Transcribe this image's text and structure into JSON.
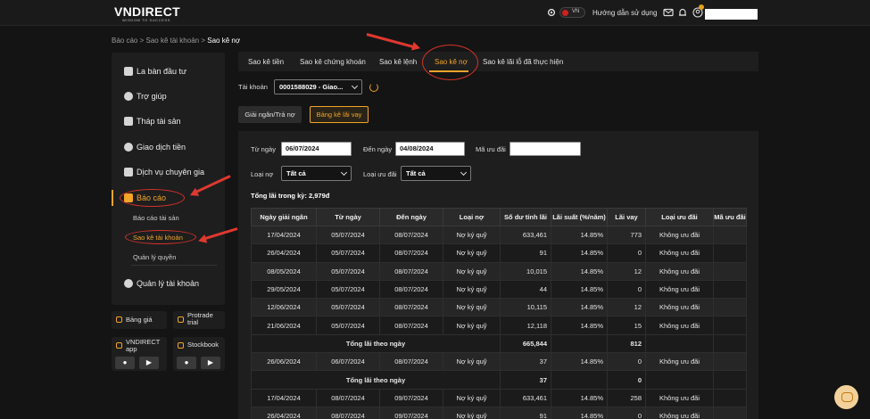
{
  "header": {
    "logo": "VNDIRECT",
    "tagline": "WISDOM TO SUCCESS",
    "lang": "VN",
    "guide": "Hướng dẫn sử dụng"
  },
  "breadcrumb": [
    "Báo cáo",
    ">",
    "Sao kê tài khoản",
    ">",
    "Sao kê nợ"
  ],
  "sidebar": {
    "items": [
      {
        "label": "La bàn đầu tư"
      },
      {
        "label": "Trợ giúp"
      },
      {
        "label": "Tháp tài sản"
      },
      {
        "label": "Giao dịch tiền"
      },
      {
        "label": "Dịch vụ chuyên gia"
      },
      {
        "label": "Báo cáo"
      },
      {
        "label": "Quản lý tài khoản"
      }
    ],
    "sub_items": [
      {
        "label": "Báo cáo tài sản"
      },
      {
        "label": "Sao kê tài khoản"
      },
      {
        "label": "Quản lý quyền"
      }
    ],
    "quick": [
      {
        "label": "Bảng giá"
      },
      {
        "label": "Protrade trial"
      },
      {
        "label": "VNDIRECT app"
      },
      {
        "label": "Stockbook"
      }
    ]
  },
  "tabs": [
    "Sao kê tiền",
    "Sao kê chứng khoán",
    "Sao kê lệnh",
    "Sao kê nợ",
    "Sao kê lãi lỗ đã thực hiện"
  ],
  "account": {
    "label": "Tài khoản",
    "value": "0001588029 - Giao..."
  },
  "subtabs": [
    "Giải ngân/Trả nợ",
    "Bảng kê lãi vay"
  ],
  "filters": {
    "from_label": "Từ ngày",
    "from_value": "06/07/2024",
    "to_label": "Đến ngày",
    "to_value": "04/08/2024",
    "promo_code_label": "Mã ưu đãi",
    "promo_code_value": "",
    "debt_type_label": "Loại nợ",
    "debt_type_value": "Tất cả",
    "promo_type_label": "Loại ưu đãi",
    "promo_type_value": "Tất cả"
  },
  "total_interest": "Tổng lãi trong kỳ: 2,979đ",
  "table": {
    "headers": [
      "Ngày giải ngân",
      "Từ ngày",
      "Đến ngày",
      "Loại nợ",
      "Số dư tính lãi",
      "Lãi suất (%/năm)",
      "Lãi vay",
      "Loại ưu đãi",
      "Mã ưu đãi"
    ],
    "rows": [
      {
        "type": "data",
        "cells": [
          "17/04/2024",
          "05/07/2024",
          "08/07/2024",
          "Nợ ký quỹ",
          "633,461",
          "14.85%",
          "773",
          "Không ưu đãi",
          ""
        ]
      },
      {
        "type": "data",
        "cells": [
          "26/04/2024",
          "05/07/2024",
          "08/07/2024",
          "Nợ ký quỹ",
          "91",
          "14.85%",
          "0",
          "Không ưu đãi",
          ""
        ]
      },
      {
        "type": "data",
        "cells": [
          "08/05/2024",
          "05/07/2024",
          "08/07/2024",
          "Nợ ký quỹ",
          "10,015",
          "14.85%",
          "12",
          "Không ưu đãi",
          ""
        ]
      },
      {
        "type": "data",
        "cells": [
          "29/05/2024",
          "05/07/2024",
          "08/07/2024",
          "Nợ ký quỹ",
          "44",
          "14.85%",
          "0",
          "Không ưu đãi",
          ""
        ]
      },
      {
        "type": "data",
        "cells": [
          "12/06/2024",
          "05/07/2024",
          "08/07/2024",
          "Nợ ký quỹ",
          "10,115",
          "14.85%",
          "12",
          "Không ưu đãi",
          ""
        ]
      },
      {
        "type": "data",
        "cells": [
          "21/06/2024",
          "05/07/2024",
          "08/07/2024",
          "Nợ ký quỹ",
          "12,118",
          "14.85%",
          "15",
          "Không ưu đãi",
          ""
        ]
      },
      {
        "type": "sum",
        "label": "Tổng lãi theo ngày",
        "balance": "665,844",
        "interest": "812"
      },
      {
        "type": "data",
        "cells": [
          "26/06/2024",
          "06/07/2024",
          "08/07/2024",
          "Nợ ký quỹ",
          "37",
          "14.85%",
          "0",
          "Không ưu đãi",
          ""
        ]
      },
      {
        "type": "sum",
        "label": "Tổng lãi theo ngày",
        "balance": "37",
        "interest": "0"
      },
      {
        "type": "data",
        "cells": [
          "17/04/2024",
          "08/07/2024",
          "09/07/2024",
          "Nợ ký quỹ",
          "633,461",
          "14.85%",
          "258",
          "Không ưu đãi",
          ""
        ]
      },
      {
        "type": "data",
        "cells": [
          "26/04/2024",
          "08/07/2024",
          "09/07/2024",
          "Nợ ký quỹ",
          "91",
          "14.85%",
          "0",
          "Không ưu đãi",
          ""
        ]
      }
    ]
  },
  "colors": {
    "accent": "#f1a428",
    "annotation": "#e0382f",
    "background": "#141414"
  }
}
